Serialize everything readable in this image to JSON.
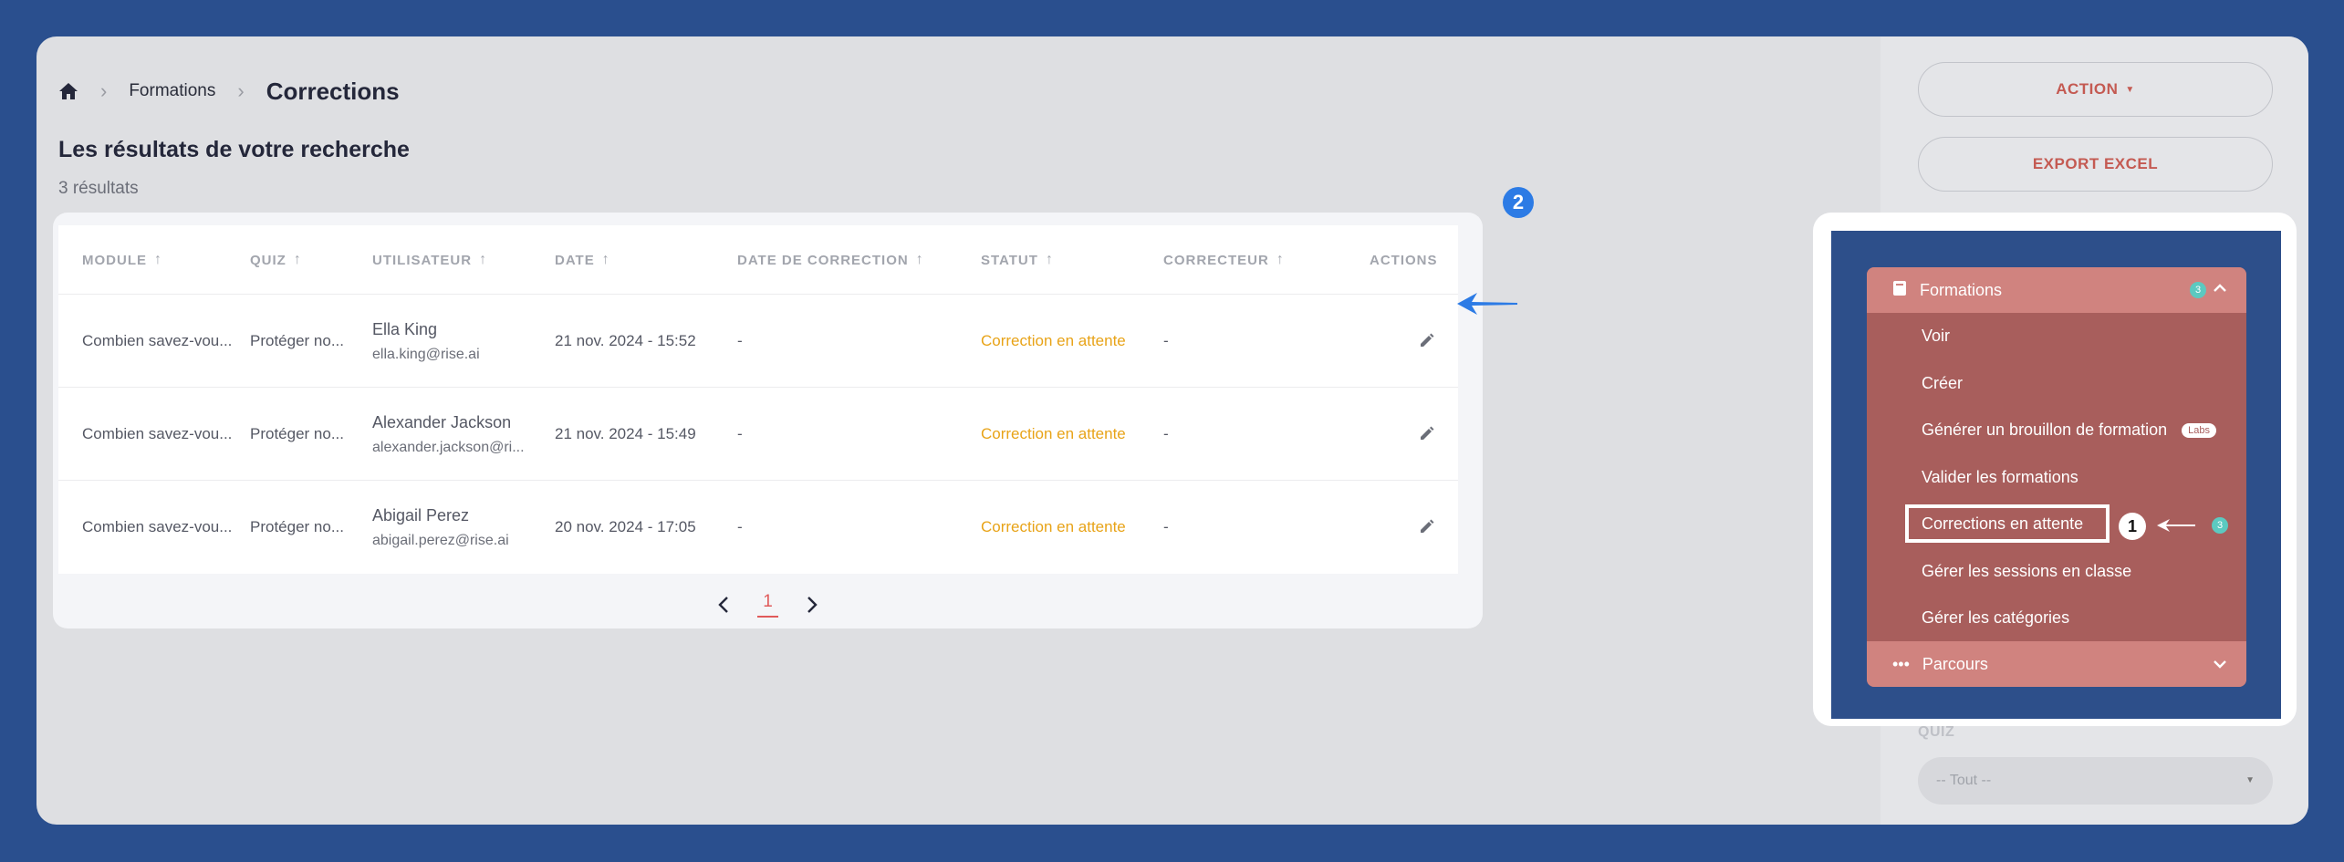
{
  "breadcrumb": {
    "home_icon": "home-icon",
    "parent": "Formations",
    "current": "Corrections"
  },
  "results": {
    "title": "Les résultats de votre recherche",
    "count": "3 résultats"
  },
  "table": {
    "columns": [
      {
        "label": "MODULE",
        "sortable": true
      },
      {
        "label": "QUIZ",
        "sortable": true
      },
      {
        "label": "UTILISATEUR",
        "sortable": true
      },
      {
        "label": "DATE",
        "sortable": true
      },
      {
        "label": "DATE DE CORRECTION",
        "sortable": true
      },
      {
        "label": "STATUT",
        "sortable": true
      },
      {
        "label": "CORRECTEUR",
        "sortable": true
      },
      {
        "label": "ACTIONS",
        "sortable": false
      }
    ],
    "sort_icon": "↑",
    "rows": [
      {
        "module": "Combien savez-vou...",
        "quiz": "Protéger no...",
        "user_name": "Ella King",
        "user_email": "ella.king@rise.ai",
        "date": "21 nov. 2024 - 15:52",
        "correction_date": "-",
        "status": "Correction en attente",
        "corrector": "-"
      },
      {
        "module": "Combien savez-vou...",
        "quiz": "Protéger no...",
        "user_name": "Alexander Jackson",
        "user_email": "alexander.jackson@ri...",
        "date": "21 nov. 2024 - 15:49",
        "correction_date": "-",
        "status": "Correction en attente",
        "corrector": "-"
      },
      {
        "module": "Combien savez-vou...",
        "quiz": "Protéger no...",
        "user_name": "Abigail Perez",
        "user_email": "abigail.perez@rise.ai",
        "date": "20 nov. 2024 - 17:05",
        "correction_date": "-",
        "status": "Correction en attente",
        "corrector": "-"
      }
    ]
  },
  "pagination": {
    "current": "1"
  },
  "annotations": {
    "step2": "2",
    "step1": "1"
  },
  "sidebar": {
    "action_label": "ACTION",
    "export_label": "EXPORT EXCEL",
    "quiz_label": "QUIZ",
    "quiz_select": "-- Tout --"
  },
  "menu": {
    "section": "Formations",
    "section_count": "3",
    "items": [
      {
        "label": "Voir"
      },
      {
        "label": "Créer"
      },
      {
        "label": "Générer un brouillon de formation",
        "badge": "Labs"
      },
      {
        "label": "Valider les formations"
      },
      {
        "label": "Corrections en attente",
        "count": "3",
        "active": true
      },
      {
        "label": "Gérer les sessions en classe"
      },
      {
        "label": "Gérer les catégories"
      }
    ],
    "next_section": "Parcours"
  },
  "colors": {
    "background": "#2a4f8e",
    "accent": "#c45a52",
    "status_pending": "#e8a317",
    "menu_bg": "#a85e5c",
    "badge_blue": "#2c7be5",
    "count_teal": "#5cc9c0"
  }
}
